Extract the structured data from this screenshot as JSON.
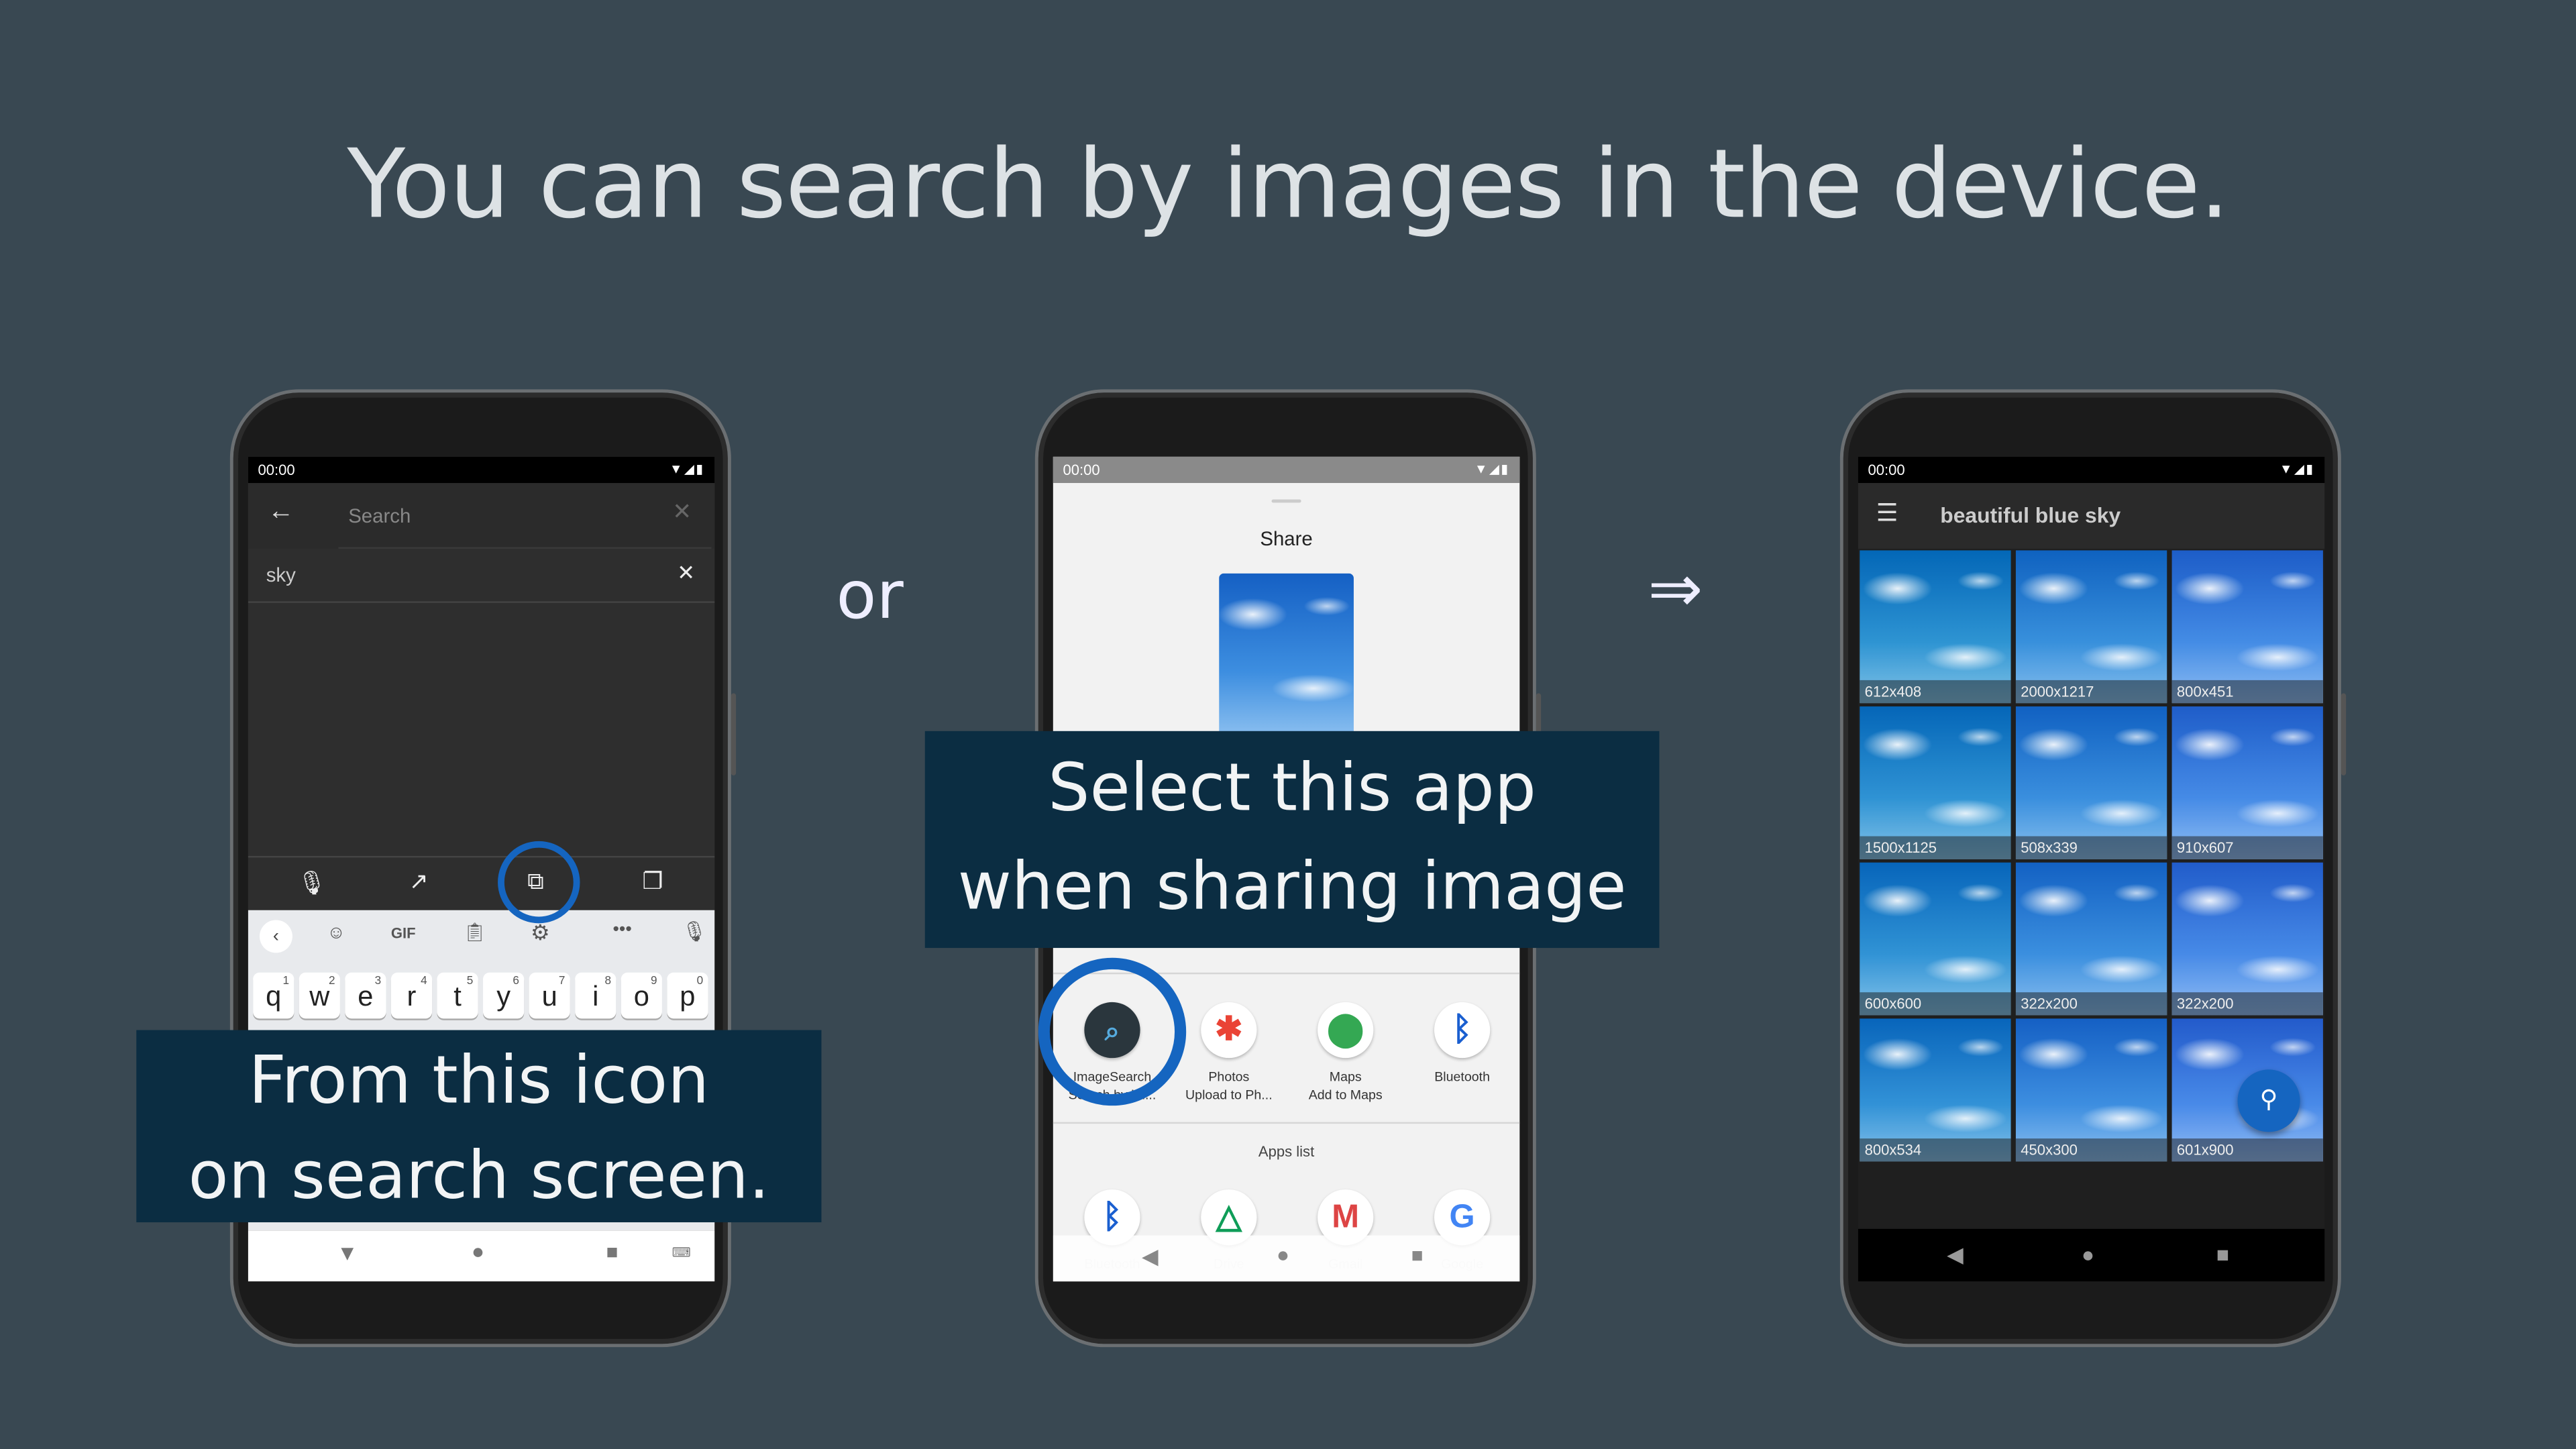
{
  "headline": "You can search by images in the device.",
  "connector_or": "or",
  "connector_arrow": "⇒",
  "status_time": "00:00",
  "phone1": {
    "search_placeholder": "Search",
    "history_item": "sky",
    "toolbar_icons": [
      "mic-icon",
      "trending-icon",
      "image-search-icon",
      "copy-icon"
    ],
    "keyboard_suggestions": [
      "<",
      "sticker",
      "GIF",
      "clipboard",
      "settings",
      "...",
      "mic"
    ],
    "gif_label": "GIF",
    "keys": [
      "q",
      "w",
      "e",
      "r",
      "t",
      "y",
      "u",
      "i",
      "o",
      "p"
    ],
    "key_hints": [
      "1",
      "2",
      "3",
      "4",
      "5",
      "6",
      "7",
      "8",
      "9",
      "0"
    ],
    "caption": [
      "From this icon",
      "on search screen."
    ]
  },
  "phone2": {
    "sheet_title": "Share",
    "direct_share": [
      {
        "name": "ImageSearch",
        "sub": "Search by im..."
      },
      {
        "name": "Photos",
        "sub": "Upload to Ph..."
      },
      {
        "name": "Maps",
        "sub": "Add to Maps"
      },
      {
        "name": "Bluetooth",
        "sub": ""
      }
    ],
    "apps_list_label": "Apps list",
    "apps": [
      "Bluetooth",
      "Drive",
      "Gmail",
      "Google"
    ],
    "caption": [
      "Select this app",
      "when sharing image"
    ]
  },
  "phone3": {
    "query": "beautiful blue sky",
    "images": [
      "612x408",
      "2000x1217",
      "800x451",
      "1500x1125",
      "508x339",
      "910x607",
      "600x600",
      "322x200",
      "322x200",
      "800x534",
      "450x300",
      "601x900"
    ]
  },
  "colors": {
    "background": "#394852",
    "caption_bg": "#0b2d42",
    "highlight": "#1565c0"
  }
}
